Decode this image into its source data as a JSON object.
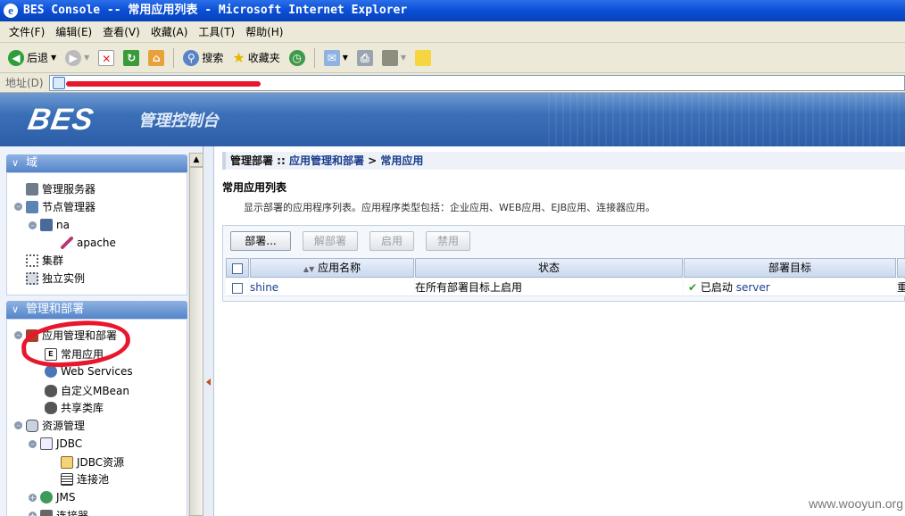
{
  "window": {
    "title": "BES Console -- 常用应用列表 - Microsoft Internet Explorer"
  },
  "menu": [
    "文件(F)",
    "编辑(E)",
    "查看(V)",
    "收藏(A)",
    "工具(T)",
    "帮助(H)"
  ],
  "toolbar": {
    "back": "后退",
    "search": "搜索",
    "favorites": "收藏夹"
  },
  "address": {
    "label": "地址(D)",
    "value": ""
  },
  "banner": {
    "logo": "BES",
    "subtitle": "管理控制台"
  },
  "sidebar": {
    "domain_header": "域",
    "domain_nodes": {
      "admin_server": "管理服务器",
      "node_manager": "节点管理器",
      "na": "na",
      "apache": "apache",
      "cluster": "集群",
      "standalone": "独立实例"
    },
    "deploy_header": "管理和部署",
    "deploy_nodes": {
      "app_mgmt": "应用管理和部署",
      "common_apps": "常用应用",
      "web_services": "Web Services",
      "custom_mbean": "自定义MBean",
      "shared_lib": "共享类库",
      "resource_mgmt": "资源管理",
      "jdbc": "JDBC",
      "jdbc_resource": "JDBC资源",
      "conn_pool": "连接池",
      "jms": "JMS",
      "connector": "连接器"
    }
  },
  "breadcrumb": {
    "part1": "管理部署 :: ",
    "part2": "应用管理和部署",
    "part3": " > ",
    "part4": "常用应用"
  },
  "page": {
    "title": "常用应用列表",
    "description": "显示部署的应用程序列表。应用程序类型包括：企业应用、WEB应用、EJB应用、连接器应用。"
  },
  "buttons": {
    "deploy": "部署...",
    "undeploy": "解部署",
    "enable": "启用",
    "disable": "禁用"
  },
  "table": {
    "headers": [
      "应用名称",
      "状态",
      "部署目标"
    ],
    "rows": [
      {
        "name": "shine",
        "status": "在所有部署目标上启用",
        "target_state": "已启动",
        "target": "server",
        "extra": "重"
      }
    ]
  },
  "watermark": "www.wooyun.org"
}
